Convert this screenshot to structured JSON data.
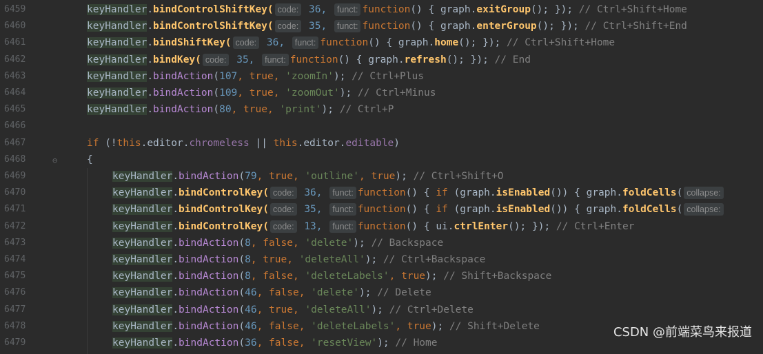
{
  "line_numbers": [
    "6459",
    "6460",
    "6461",
    "6462",
    "6463",
    "6464",
    "6465",
    "6466",
    "6467",
    "6468",
    "6469",
    "6470",
    "6471",
    "6472",
    "6473",
    "6474",
    "6475",
    "6476",
    "6477",
    "6478",
    "6479"
  ],
  "lines": [
    {
      "obj": "keyHandler",
      "meth": "bindControlShiftKey(",
      "hint1": "code:",
      "arg1": " 36,",
      "hint2": "funct:",
      "body": "function() { graph.",
      "call": "exitGroup",
      "tail": "(); });",
      "comment": " // Ctrl+Shift+Home"
    },
    {
      "obj": "keyHandler",
      "meth": "bindControlShiftKey(",
      "hint1": "code:",
      "arg1": " 35,",
      "hint2": "funct:",
      "body": "function() { graph.",
      "call": "enterGroup",
      "tail": "(); });",
      "comment": " // Ctrl+Shift+End"
    },
    {
      "obj": "keyHandler",
      "meth": "bindShiftKey(",
      "hint1": "code:",
      "arg1": " 36,",
      "hint2": "funct:",
      "body": "function() { graph.",
      "call": "home",
      "tail": "(); });",
      "comment": " // Ctrl+Shift+Home"
    },
    {
      "obj": "keyHandler",
      "meth": "bindKey(",
      "hint1": "code:",
      "arg1": " 35,",
      "hint2": "funct:",
      "body": "function() { graph.",
      "call": "refresh",
      "tail": "(); });",
      "comment": " // End"
    },
    {
      "obj": "keyHandler",
      "act": "bindAction(",
      "num": "107",
      "sep": ", ",
      "bool": "true",
      "str": "'zoomIn'",
      "end": ");",
      "comment": " // Ctrl+Plus"
    },
    {
      "obj": "keyHandler",
      "act": "bindAction(",
      "num": "109",
      "sep": ", ",
      "bool": "true",
      "str": "'zoomOut'",
      "end": ");",
      "comment": " // Ctrl+Minus"
    },
    {
      "obj": "keyHandler",
      "act": "bindAction(",
      "num": "80",
      "sep": ", ",
      "bool": "true",
      "str": "'print'",
      "end": ");",
      "comment": " // Ctrl+P"
    },
    {},
    {
      "if_kw": "if",
      "if_open": " (!",
      "this1": "this",
      "p1": ".editor.",
      "prop1": "chromeless",
      "or": " || ",
      "this2": "this",
      "p2": ".editor.",
      "prop2": "editable",
      "if_close": ")"
    },
    {
      "brace": "{"
    },
    {
      "obj": "keyHandler",
      "act": "bindAction(",
      "num": "79",
      "sep": ", ",
      "bool": "true",
      "str": "'outline'",
      "bool2": "true",
      "end": ");",
      "comment": " // Ctrl+Shift+O"
    },
    {
      "obj": "keyHandler",
      "meth": "bindControlKey(",
      "hint1": "code:",
      "arg1": " 36,",
      "hint2": "funct:",
      "body2": "function() { ",
      "ifk": "if",
      "mid": " (graph.",
      "call": "isEnabled",
      "mid2": "()) { graph.",
      "call2": "foldCells",
      "hint3": "collapse:"
    },
    {
      "obj": "keyHandler",
      "meth": "bindControlKey(",
      "hint1": "code:",
      "arg1": " 35,",
      "hint2": "funct:",
      "body2": "function() { ",
      "ifk": "if",
      "mid": " (graph.",
      "call": "isEnabled",
      "mid2": "()) { graph.",
      "call2": "foldCells",
      "hint3": "collapse:"
    },
    {
      "obj": "keyHandler",
      "meth": "bindControlKey(",
      "hint1": "code:",
      "arg1": " 13,",
      "hint2": "funct:",
      "body": "function() { ui.",
      "call": "ctrlEnter",
      "tail": "(); });",
      "comment": " // Ctrl+Enter"
    },
    {
      "obj": "keyHandler",
      "act": "bindAction(",
      "num": "8",
      "sep": ", ",
      "bool": "false",
      "str": "'delete'",
      "end": ");",
      "comment": " // Backspace"
    },
    {
      "obj": "keyHandler",
      "act": "bindAction(",
      "num": "8",
      "sep": ", ",
      "bool": "true",
      "str": "'deleteAll'",
      "end": ");",
      "comment": " // Ctrl+Backspace"
    },
    {
      "obj": "keyHandler",
      "act": "bindAction(",
      "num": "8",
      "sep": ", ",
      "bool": "false",
      "str": "'deleteLabels'",
      "bool2": "true",
      "end": ");",
      "comment": " // Shift+Backspace"
    },
    {
      "obj": "keyHandler",
      "act": "bindAction(",
      "num": "46",
      "sep": ", ",
      "bool": "false",
      "str": "'delete'",
      "end": ");",
      "comment": " // Delete"
    },
    {
      "obj": "keyHandler",
      "act": "bindAction(",
      "num": "46",
      "sep": ", ",
      "bool": "true",
      "str": "'deleteAll'",
      "end": ");",
      "comment": " // Ctrl+Delete"
    },
    {
      "obj": "keyHandler",
      "act": "bindAction(",
      "num": "46",
      "sep": ", ",
      "bool": "false",
      "str": "'deleteLabels'",
      "bool2": "true",
      "end": ");",
      "comment": " // Shift+Delete"
    },
    {
      "obj": "keyHandler",
      "act": "bindAction(",
      "num": "36",
      "sep": ", ",
      "bool": "false",
      "str": "'resetView'",
      "end": ");",
      "comment": " // Home"
    }
  ],
  "watermark": "CSDN @前端菜鸟来报道",
  "colors": {
    "background": "#2b2b2b",
    "keyword": "#cc7832",
    "string": "#6a8759",
    "number": "#6897bb",
    "comment": "#808080",
    "method": "#ffc66d",
    "highlight": "#344134"
  }
}
